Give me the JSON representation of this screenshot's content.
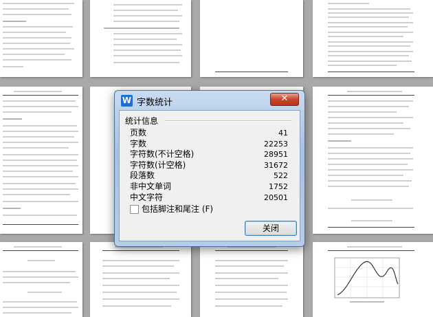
{
  "dialog": {
    "title": "字数统计",
    "app_icon_letter": "W",
    "close_glyph": "✕",
    "group_label": "统计信息",
    "stats": [
      {
        "label": "页数",
        "value": "41"
      },
      {
        "label": "字数",
        "value": "22253"
      },
      {
        "label": "字符数(不计空格)",
        "value": "28951"
      },
      {
        "label": "字符数(计空格)",
        "value": "31672"
      },
      {
        "label": "段落数",
        "value": "522"
      },
      {
        "label": "非中文单词",
        "value": "1752"
      },
      {
        "label": "中文字符",
        "value": "20501"
      }
    ],
    "checkbox_label": "包括脚注和尾注 (F)",
    "checkbox_checked": false,
    "close_button_label": "关闭"
  },
  "colors": {
    "background": "#a9a9a9",
    "page": "#ffffff",
    "dialog_frame": "#b7cde6",
    "close_button": "#c9462b"
  }
}
